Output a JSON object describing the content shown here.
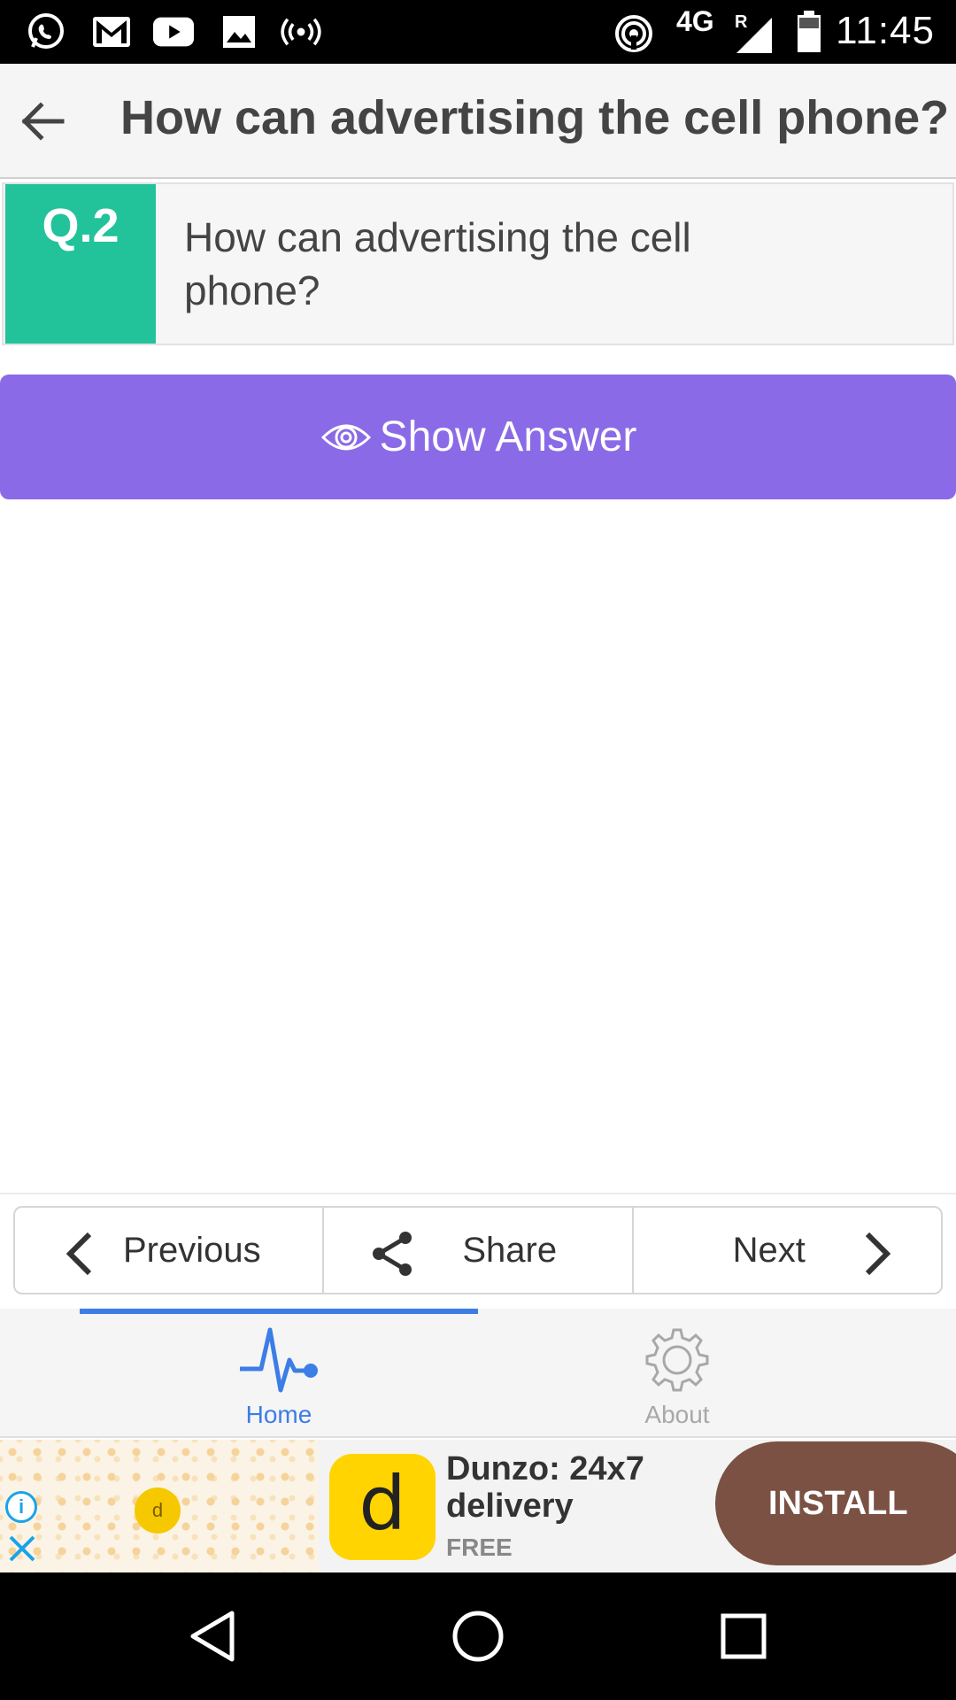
{
  "status_bar": {
    "time": "11:45",
    "network": "4G",
    "roaming": "R",
    "left_icons": [
      "whatsapp-icon",
      "gmail-icon",
      "youtube-icon",
      "gallery-icon",
      "hotspot-icon"
    ],
    "right_icons": [
      "wifi-hotspot-icon",
      "signal-icon",
      "battery-icon"
    ]
  },
  "appbar": {
    "title": "How can advertising the cell phone?"
  },
  "question": {
    "badge": "Q.2",
    "text": "How can advertising the cell phone?"
  },
  "show_answer": {
    "label": "Show Answer"
  },
  "nav": {
    "previous": "Previous",
    "share": "Share",
    "next": "Next"
  },
  "tabs": [
    {
      "label": "Home",
      "active": true
    },
    {
      "label": "About",
      "active": false
    }
  ],
  "ad": {
    "badge_letter": "d",
    "logo_letter": "d",
    "title": "Dunzo: 24x7 delivery",
    "price": "FREE",
    "install": "INSTALL"
  },
  "colors": {
    "badge": "#22c29b",
    "show_answer": "#8a6ae6",
    "tab_active": "#3c7de6",
    "install": "#7b5144",
    "ad_logo": "#ffd400"
  }
}
